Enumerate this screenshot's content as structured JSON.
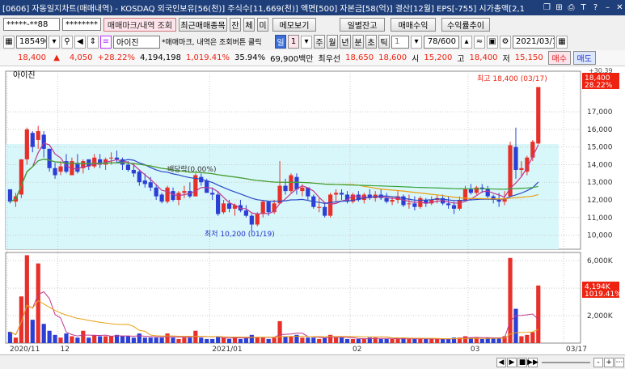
{
  "titlebar": {
    "text": "[0606] 자동일지차트(매매내역) - KOSDAQ 외국인보유[56(천)] 주식수[11,669(천)] 액면[500] 자본금[58(억)] 결산[12월] EPS[-755] 시가총액[2,1",
    "icons": [
      "restore-icon",
      "pin-icon",
      "print-icon",
      "font-icon",
      "help-icon",
      "minimize-icon",
      "close-icon"
    ]
  },
  "toolbar1": {
    "account": "*****-**88",
    "password": "********",
    "tabs": [
      "매매마크/내역 조회",
      "최근매매종목"
    ],
    "small_buttons": [
      "잔",
      "체",
      "미"
    ],
    "memo": "메모보기",
    "buttons": [
      "일별잔고",
      "매매수익",
      "수익률추이"
    ]
  },
  "toolbar2": {
    "code": "185490",
    "stock_name": "아이진",
    "notice": "*매매마크, 내역은 조회버튼 클릭",
    "period_buttons": [
      "일",
      "1",
      "주",
      "월",
      "년",
      "분",
      "초",
      "틱"
    ],
    "count_value": "1",
    "range": "78/600",
    "date": "2021/03/17"
  },
  "quote": {
    "price": "18,400",
    "arrow": "▲",
    "change": "4,050",
    "change_pct": "+28.22%",
    "volume": "4,194,198",
    "volume_pct": "1,019.41%",
    "turnover": "35.94%",
    "amount": "69,900백만",
    "best_ask_label": "최우선",
    "best_ask": "18,650",
    "best_bid": "18,600",
    "open_label": "시",
    "open": "15,200",
    "high_label": "고",
    "high": "18,400",
    "low_label": "저",
    "low": "15,150",
    "buy": "매수",
    "sell": "매도"
  },
  "chart_labels": {
    "legend": "아이진",
    "high_note": "최고 18,400 (03/17)",
    "low_note": "최저 10,200 (01/19)",
    "dividend_note": "배당락(0.00%)",
    "price_tag": "18,400",
    "pct_tag": "28.22%",
    "top_tag": "+30.39",
    "vol_tag": "4,194K",
    "vol_pct_tag": "1019.41%"
  },
  "colors": {
    "up": "#e8302a",
    "down": "#2b3fd6",
    "bg_band": "#d8f7fa",
    "title_bg": "#1f3f7a"
  },
  "bottombar": {
    "controls": [
      "◀",
      "▶",
      "■",
      "▶▶",
      "-",
      "+"
    ]
  },
  "chart_data": {
    "type": "candlestick",
    "title": "아이진",
    "price_axis": {
      "ticks": [
        "10,000",
        "11,000",
        "12,000",
        "13,000",
        "14,000",
        "15,000",
        "16,000",
        "17,000"
      ],
      "ylim": [
        9200,
        19300
      ]
    },
    "volume_axis": {
      "ticks": [
        "2,000K",
        "4,000K",
        "6,000K"
      ],
      "ylim": [
        0,
        6600
      ]
    },
    "x_labels": [
      {
        "text": "2020/11",
        "i": 0
      },
      {
        "text": "12",
        "i": 9
      },
      {
        "text": "2021/01",
        "i": 36
      },
      {
        "text": "02",
        "i": 61
      },
      {
        "text": "03",
        "i": 82
      },
      {
        "text": "03/17",
        "i": 99
      }
    ],
    "candles": [
      [
        12600,
        12600,
        11800,
        11900,
        820
      ],
      [
        11900,
        12400,
        11600,
        12200,
        400
      ],
      [
        12300,
        14300,
        12100,
        14300,
        3400
      ],
      [
        14300,
        16100,
        14000,
        16000,
        6400
      ],
      [
        15800,
        15900,
        14700,
        15000,
        1700
      ],
      [
        15400,
        16200,
        14900,
        15900,
        5800
      ],
      [
        15700,
        15900,
        14400,
        14900,
        1400
      ],
      [
        14900,
        14900,
        13600,
        13800,
        900
      ],
      [
        13800,
        14100,
        13200,
        13400,
        600
      ],
      [
        13600,
        14200,
        13400,
        13900,
        400
      ],
      [
        14200,
        14600,
        13500,
        13600,
        700
      ],
      [
        13400,
        14400,
        13400,
        14200,
        500
      ],
      [
        14100,
        14600,
        13500,
        13600,
        400
      ],
      [
        13800,
        14300,
        13500,
        14200,
        900
      ],
      [
        14300,
        14300,
        13700,
        13900,
        400
      ],
      [
        13900,
        14600,
        13800,
        14400,
        600
      ],
      [
        14300,
        14600,
        13800,
        14000,
        500
      ],
      [
        14000,
        14400,
        13700,
        14300,
        500
      ],
      [
        14400,
        14700,
        14000,
        14400,
        500
      ],
      [
        14400,
        14800,
        14100,
        14300,
        600
      ],
      [
        14300,
        14400,
        13700,
        14000,
        500
      ],
      [
        14000,
        14200,
        13600,
        13700,
        500
      ],
      [
        13700,
        14100,
        13300,
        13500,
        400
      ],
      [
        13600,
        13700,
        12800,
        13000,
        700
      ],
      [
        13100,
        13500,
        12700,
        12900,
        400
      ],
      [
        13000,
        13300,
        12500,
        12700,
        400
      ],
      [
        12700,
        12900,
        12000,
        12200,
        400
      ],
      [
        12300,
        12400,
        11800,
        11900,
        400
      ],
      [
        11900,
        12800,
        11800,
        12700,
        700
      ],
      [
        12500,
        12700,
        11900,
        12000,
        400
      ],
      [
        12000,
        12500,
        11700,
        12400,
        300
      ],
      [
        12400,
        12800,
        12100,
        12500,
        400
      ],
      [
        12500,
        13000,
        12100,
        12200,
        400
      ],
      [
        12200,
        13500,
        12200,
        13400,
        900
      ],
      [
        13300,
        13500,
        12800,
        13000,
        400
      ],
      [
        13100,
        13200,
        12400,
        12400,
        300
      ],
      [
        12400,
        12700,
        12000,
        12300,
        300
      ],
      [
        12300,
        12500,
        11100,
        11200,
        500
      ],
      [
        11300,
        12000,
        11200,
        11800,
        400
      ],
      [
        11800,
        12000,
        11300,
        11500,
        300
      ],
      [
        11500,
        11800,
        11100,
        11700,
        400
      ],
      [
        11700,
        12000,
        11300,
        11400,
        300
      ],
      [
        11400,
        11700,
        11000,
        11100,
        400
      ],
      [
        11100,
        11200,
        10200,
        10600,
        600
      ],
      [
        10600,
        11300,
        10500,
        11200,
        400
      ],
      [
        11200,
        12000,
        11000,
        11900,
        400
      ],
      [
        11900,
        11700,
        11100,
        11300,
        300
      ],
      [
        11300,
        12000,
        11200,
        11800,
        400
      ],
      [
        11800,
        14200,
        11800,
        12800,
        1600
      ],
      [
        12800,
        13200,
        12300,
        12500,
        500
      ],
      [
        12500,
        13500,
        12400,
        13400,
        500
      ],
      [
        13300,
        13500,
        12300,
        12600,
        600
      ],
      [
        12500,
        12900,
        12200,
        12700,
        400
      ],
      [
        12700,
        12700,
        12000,
        12200,
        400
      ],
      [
        12200,
        12300,
        11500,
        11600,
        400
      ],
      [
        11600,
        12100,
        11300,
        11600,
        300
      ],
      [
        11600,
        11800,
        11000,
        11100,
        400
      ],
      [
        11100,
        12400,
        11000,
        12300,
        600
      ],
      [
        12300,
        12600,
        11900,
        12400,
        400
      ],
      [
        12400,
        12600,
        12000,
        12300,
        400
      ],
      [
        12300,
        12500,
        11800,
        11900,
        300
      ],
      [
        11900,
        12400,
        11800,
        12300,
        300
      ],
      [
        12300,
        12500,
        11900,
        12000,
        300
      ],
      [
        12000,
        12400,
        11800,
        12300,
        300
      ],
      [
        12300,
        12600,
        12000,
        12100,
        400
      ],
      [
        12100,
        12500,
        11900,
        12300,
        400
      ],
      [
        12300,
        12600,
        12000,
        12100,
        300
      ],
      [
        12100,
        12400,
        11800,
        11900,
        300
      ],
      [
        11900,
        12200,
        11700,
        12000,
        300
      ],
      [
        12000,
        12500,
        11800,
        12200,
        300
      ],
      [
        12200,
        12300,
        11600,
        11700,
        400
      ],
      [
        11800,
        12300,
        11500,
        11800,
        300
      ],
      [
        11800,
        12200,
        11400,
        11600,
        300
      ],
      [
        11600,
        12200,
        11500,
        12100,
        300
      ],
      [
        12000,
        12100,
        11600,
        11800,
        300
      ],
      [
        11800,
        12200,
        11700,
        12000,
        300
      ],
      [
        12000,
        12300,
        11800,
        12100,
        300
      ],
      [
        12100,
        12300,
        11700,
        11800,
        300
      ],
      [
        11800,
        12200,
        11500,
        11700,
        300
      ],
      [
        11700,
        11900,
        11200,
        11500,
        400
      ],
      [
        11500,
        12200,
        11400,
        12000,
        400
      ],
      [
        12000,
        12800,
        11900,
        12600,
        500
      ],
      [
        12600,
        12900,
        12300,
        12400,
        400
      ],
      [
        12400,
        12800,
        12300,
        12700,
        400
      ],
      [
        12700,
        12900,
        12400,
        12600,
        300
      ],
      [
        12600,
        12800,
        12100,
        12200,
        400
      ],
      [
        12200,
        12300,
        11800,
        12000,
        400
      ],
      [
        12000,
        12400,
        11600,
        11900,
        400
      ],
      [
        11900,
        12500,
        11700,
        12100,
        500
      ],
      [
        12200,
        15300,
        12200,
        15100,
        6200
      ],
      [
        15000,
        16100,
        13200,
        13700,
        2500
      ],
      [
        13700,
        14200,
        13300,
        13800,
        500
      ],
      [
        13600,
        14500,
        13400,
        14400,
        600
      ],
      [
        14400,
        15400,
        14200,
        15300,
        800
      ],
      [
        15200,
        18400,
        15150,
        18400,
        4194
      ]
    ]
  }
}
